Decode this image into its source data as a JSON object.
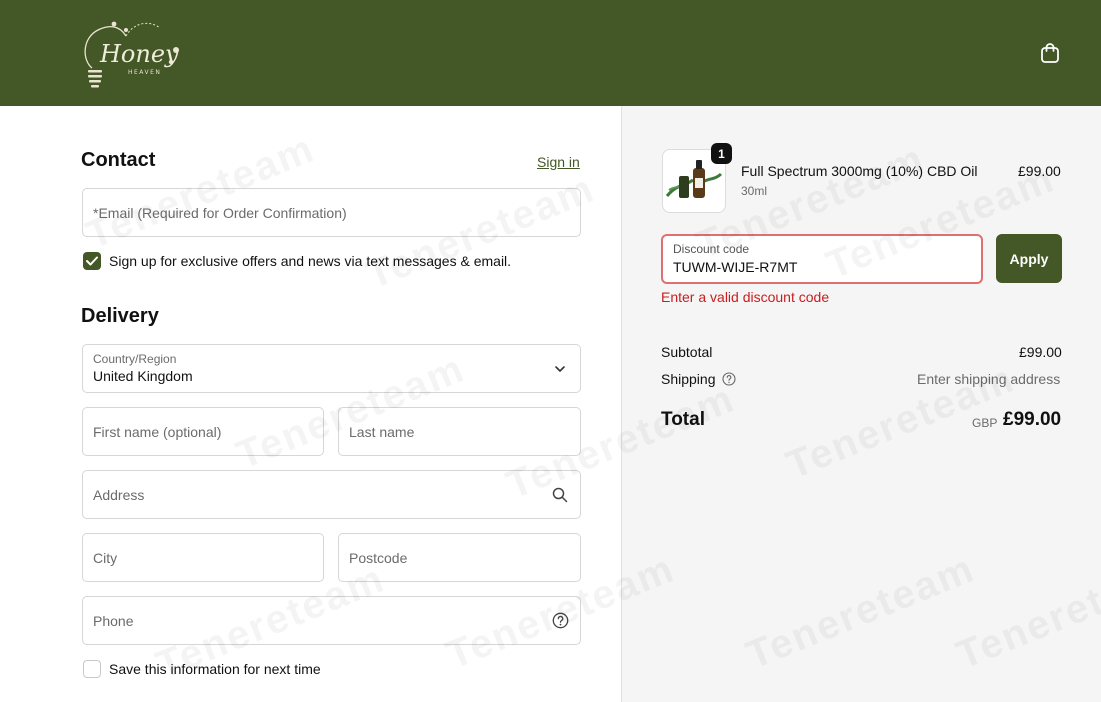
{
  "header": {
    "logo_text": "Honey",
    "logo_subtext": "HEAVEN",
    "cart_icon": "shopping-bag-icon",
    "bg_color": "#445726"
  },
  "contact": {
    "heading": "Contact",
    "signin_label": "Sign in",
    "email_placeholder": "*Email (Required for Order Confirmation)",
    "newsletter_label": "Sign up for exclusive offers and news via text messages & email.",
    "newsletter_checked": true
  },
  "delivery": {
    "heading": "Delivery",
    "country_label": "Country/Region",
    "country_value": "United Kingdom",
    "first_name_placeholder": "First name (optional)",
    "last_name_placeholder": "Last name",
    "address_placeholder": "Address",
    "city_placeholder": "City",
    "postcode_placeholder": "Postcode",
    "phone_placeholder": "Phone",
    "save_info_label": "Save this information for next time",
    "save_info_checked": false
  },
  "summary": {
    "product": {
      "quantity": "1",
      "name": "Full Spectrum 3000mg (10%) CBD Oil",
      "variant": "30ml",
      "price": "£99.00"
    },
    "discount": {
      "label": "Discount code",
      "value": "TUWM-WIJE-R7MT",
      "apply_label": "Apply",
      "error": "Enter a valid discount code"
    },
    "subtotal_label": "Subtotal",
    "subtotal_value": "£99.00",
    "shipping_label": "Shipping",
    "shipping_value": "Enter shipping address",
    "total_label": "Total",
    "total_currency": "GBP",
    "total_value": "£99.00"
  },
  "watermark": "Tenereteam",
  "colors": {
    "brand": "#445726",
    "error": "#c81e1e",
    "error_border": "#e07070"
  }
}
